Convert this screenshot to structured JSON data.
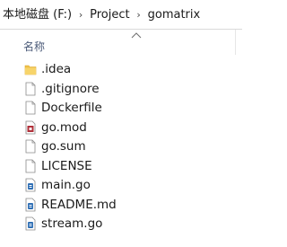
{
  "breadcrumb": {
    "items": [
      "本地磁盘 (F:)",
      "Project",
      "gomatrix"
    ],
    "separator": "›"
  },
  "columns": {
    "name_label": "名称"
  },
  "files": [
    {
      "name": ".idea",
      "icon": "folder-icon"
    },
    {
      "name": ".gitignore",
      "icon": "document-icon"
    },
    {
      "name": "Dockerfile",
      "icon": "document-icon"
    },
    {
      "name": "go.mod",
      "icon": "mod-file-icon"
    },
    {
      "name": "go.sum",
      "icon": "document-icon"
    },
    {
      "name": "LICENSE",
      "icon": "document-icon"
    },
    {
      "name": "main.go",
      "icon": "go-file-icon"
    },
    {
      "name": "README.md",
      "icon": "go-file-icon"
    },
    {
      "name": "stream.go",
      "icon": "go-file-icon"
    }
  ],
  "colors": {
    "folder": "#f0c24a",
    "go_file": "#2f6fb5",
    "mod_file": "#b0303a",
    "header_text": "#4a5a78"
  }
}
